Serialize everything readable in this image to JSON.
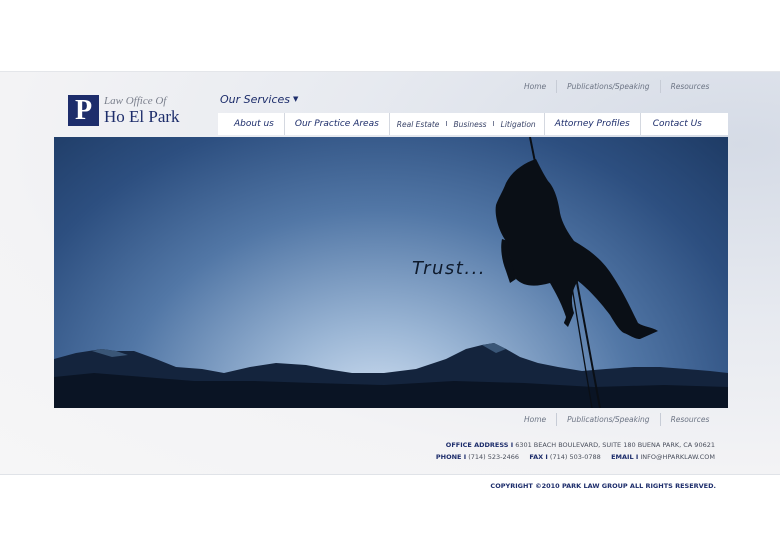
{
  "logo": {
    "mark": "P",
    "line1": "Law Office Of",
    "line2": "Ho El Park"
  },
  "services": {
    "label": "Our Services"
  },
  "top_links": [
    "Home",
    "Publications/Speaking",
    "Resources"
  ],
  "nav": {
    "about": "About us",
    "practice": "Our Practice Areas",
    "real_estate": "Real Estate",
    "business": "Business",
    "litigation": "Litigation",
    "profiles": "Attorney Profiles",
    "contact": "Contact Us",
    "pipe": "I"
  },
  "hero": {
    "tagline": "Trust..."
  },
  "bottom_links": [
    "Home",
    "Publications/Speaking",
    "Resources"
  ],
  "footer": {
    "office_label": "OFFICE ADDRESS I",
    "office_value": "6301 BEACH BOULEVARD, SUITE 180 BUENA PARK, CA  90621",
    "phone_label": "PHONE I",
    "phone_value": "(714) 523-2466",
    "fax_label": "FAX I",
    "fax_value": "(714) 503-0788",
    "email_label": "EMAIL I",
    "email_value": "INFO@HPARKLAW.COM",
    "copyright": "COPYRIGHT ©2010 PARK LAW GROUP  ALL RIGHTS RESERVED."
  },
  "colors": {
    "brand_navy": "#1d2d6b",
    "sky_dark": "#1e3b65",
    "sky_light": "#d2e1f3"
  },
  "icons": {
    "logo": "p-monogram",
    "services_caret": "caret-down-icon"
  }
}
